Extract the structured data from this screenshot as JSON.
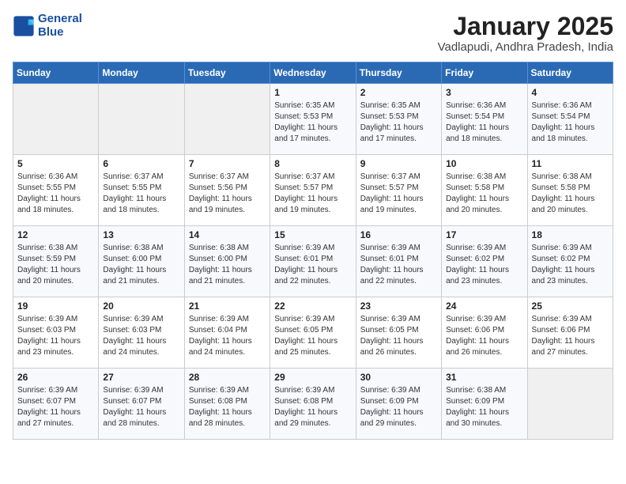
{
  "header": {
    "logo_line1": "General",
    "logo_line2": "Blue",
    "month": "January 2025",
    "location": "Vadlapudi, Andhra Pradesh, India"
  },
  "weekdays": [
    "Sunday",
    "Monday",
    "Tuesday",
    "Wednesday",
    "Thursday",
    "Friday",
    "Saturday"
  ],
  "weeks": [
    [
      {
        "day": "",
        "empty": true
      },
      {
        "day": "",
        "empty": true
      },
      {
        "day": "",
        "empty": true
      },
      {
        "day": "1",
        "sunrise": "6:35 AM",
        "sunset": "5:53 PM",
        "daylight": "11 hours and 17 minutes."
      },
      {
        "day": "2",
        "sunrise": "6:35 AM",
        "sunset": "5:53 PM",
        "daylight": "11 hours and 17 minutes."
      },
      {
        "day": "3",
        "sunrise": "6:36 AM",
        "sunset": "5:54 PM",
        "daylight": "11 hours and 18 minutes."
      },
      {
        "day": "4",
        "sunrise": "6:36 AM",
        "sunset": "5:54 PM",
        "daylight": "11 hours and 18 minutes."
      }
    ],
    [
      {
        "day": "5",
        "sunrise": "6:36 AM",
        "sunset": "5:55 PM",
        "daylight": "11 hours and 18 minutes."
      },
      {
        "day": "6",
        "sunrise": "6:37 AM",
        "sunset": "5:55 PM",
        "daylight": "11 hours and 18 minutes."
      },
      {
        "day": "7",
        "sunrise": "6:37 AM",
        "sunset": "5:56 PM",
        "daylight": "11 hours and 19 minutes."
      },
      {
        "day": "8",
        "sunrise": "6:37 AM",
        "sunset": "5:57 PM",
        "daylight": "11 hours and 19 minutes."
      },
      {
        "day": "9",
        "sunrise": "6:37 AM",
        "sunset": "5:57 PM",
        "daylight": "11 hours and 19 minutes."
      },
      {
        "day": "10",
        "sunrise": "6:38 AM",
        "sunset": "5:58 PM",
        "daylight": "11 hours and 20 minutes."
      },
      {
        "day": "11",
        "sunrise": "6:38 AM",
        "sunset": "5:58 PM",
        "daylight": "11 hours and 20 minutes."
      }
    ],
    [
      {
        "day": "12",
        "sunrise": "6:38 AM",
        "sunset": "5:59 PM",
        "daylight": "11 hours and 20 minutes."
      },
      {
        "day": "13",
        "sunrise": "6:38 AM",
        "sunset": "6:00 PM",
        "daylight": "11 hours and 21 minutes."
      },
      {
        "day": "14",
        "sunrise": "6:38 AM",
        "sunset": "6:00 PM",
        "daylight": "11 hours and 21 minutes."
      },
      {
        "day": "15",
        "sunrise": "6:39 AM",
        "sunset": "6:01 PM",
        "daylight": "11 hours and 22 minutes."
      },
      {
        "day": "16",
        "sunrise": "6:39 AM",
        "sunset": "6:01 PM",
        "daylight": "11 hours and 22 minutes."
      },
      {
        "day": "17",
        "sunrise": "6:39 AM",
        "sunset": "6:02 PM",
        "daylight": "11 hours and 23 minutes."
      },
      {
        "day": "18",
        "sunrise": "6:39 AM",
        "sunset": "6:02 PM",
        "daylight": "11 hours and 23 minutes."
      }
    ],
    [
      {
        "day": "19",
        "sunrise": "6:39 AM",
        "sunset": "6:03 PM",
        "daylight": "11 hours and 23 minutes."
      },
      {
        "day": "20",
        "sunrise": "6:39 AM",
        "sunset": "6:03 PM",
        "daylight": "11 hours and 24 minutes."
      },
      {
        "day": "21",
        "sunrise": "6:39 AM",
        "sunset": "6:04 PM",
        "daylight": "11 hours and 24 minutes."
      },
      {
        "day": "22",
        "sunrise": "6:39 AM",
        "sunset": "6:05 PM",
        "daylight": "11 hours and 25 minutes."
      },
      {
        "day": "23",
        "sunrise": "6:39 AM",
        "sunset": "6:05 PM",
        "daylight": "11 hours and 26 minutes."
      },
      {
        "day": "24",
        "sunrise": "6:39 AM",
        "sunset": "6:06 PM",
        "daylight": "11 hours and 26 minutes."
      },
      {
        "day": "25",
        "sunrise": "6:39 AM",
        "sunset": "6:06 PM",
        "daylight": "11 hours and 27 minutes."
      }
    ],
    [
      {
        "day": "26",
        "sunrise": "6:39 AM",
        "sunset": "6:07 PM",
        "daylight": "11 hours and 27 minutes."
      },
      {
        "day": "27",
        "sunrise": "6:39 AM",
        "sunset": "6:07 PM",
        "daylight": "11 hours and 28 minutes."
      },
      {
        "day": "28",
        "sunrise": "6:39 AM",
        "sunset": "6:08 PM",
        "daylight": "11 hours and 28 minutes."
      },
      {
        "day": "29",
        "sunrise": "6:39 AM",
        "sunset": "6:08 PM",
        "daylight": "11 hours and 29 minutes."
      },
      {
        "day": "30",
        "sunrise": "6:39 AM",
        "sunset": "6:09 PM",
        "daylight": "11 hours and 29 minutes."
      },
      {
        "day": "31",
        "sunrise": "6:38 AM",
        "sunset": "6:09 PM",
        "daylight": "11 hours and 30 minutes."
      },
      {
        "day": "",
        "empty": true
      }
    ]
  ],
  "labels": {
    "sunrise": "Sunrise:",
    "sunset": "Sunset:",
    "daylight": "Daylight hours"
  }
}
